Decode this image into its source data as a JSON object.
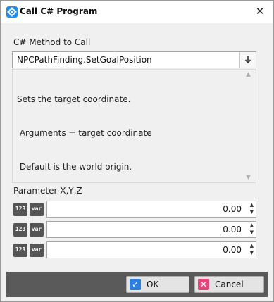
{
  "window": {
    "title": "Call C# Program",
    "icon": "app-gear-icon",
    "close_glyph": "✕"
  },
  "method": {
    "label": "C# Method to Call",
    "selected": "NPCPathFinding.SetGoalPosition",
    "dropdown_glyph": "🡇",
    "description_lines": [
      "Sets the target coordinate.",
      " Arguments = target coordinate",
      " Default is the world origin."
    ]
  },
  "parameters": {
    "label": "Parameter X,Y,Z",
    "number_icon_text": "123",
    "var_icon_text": "var",
    "values": [
      "0.00",
      "0.00",
      "0.00"
    ]
  },
  "buttons": {
    "ok": "OK",
    "cancel": "Cancel"
  },
  "colors": {
    "ok_icon": "#2f7fd8",
    "cancel_icon": "#e0487a",
    "footer_bar": "#5a5a5a"
  }
}
